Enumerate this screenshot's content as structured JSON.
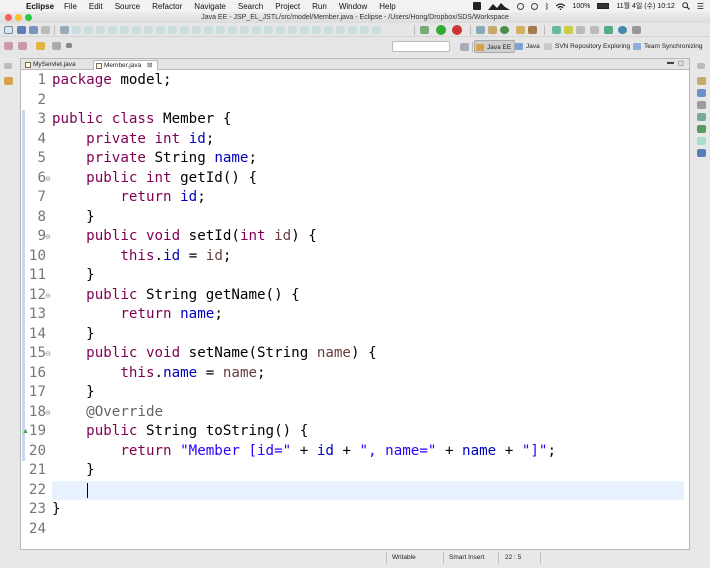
{
  "os_menubar": {
    "app_name": "Eclipse",
    "menus": [
      "File",
      "Edit",
      "Source",
      "Refactor",
      "Navigate",
      "Search",
      "Project",
      "Run",
      "Window",
      "Help"
    ],
    "battery": "100%",
    "datetime": "11월 4일 (수)  10:12"
  },
  "window": {
    "title": "Java EE - JSP_EL_JSTL/src/model/Member.java - Eclipse - /Users/Hong/Dropbox/SDS/Workspace"
  },
  "perspectives": [
    "Java EE",
    "Java",
    "SVN Repository Exploring",
    "Team Synchronizing"
  ],
  "editor": {
    "tabs": [
      {
        "label": "MyServlet.java",
        "active": false
      },
      {
        "label": "Member.java",
        "active": true,
        "close": "⊠"
      }
    ],
    "line_numbers": [
      "1",
      "2",
      "3",
      "4",
      "5",
      "6",
      "7",
      "8",
      "9",
      "10",
      "11",
      "12",
      "13",
      "14",
      "15",
      "16",
      "17",
      "18",
      "19",
      "20",
      "21",
      "22",
      "23",
      "24"
    ],
    "code": [
      {
        "t": "package model;"
      },
      {
        "t": ""
      },
      {
        "t": "public class Member {"
      },
      {
        "t": "    private int id;"
      },
      {
        "t": "    private String name;"
      },
      {
        "t": "    public int getId() {"
      },
      {
        "t": "        return id;"
      },
      {
        "t": "    }"
      },
      {
        "t": "    public void setId(int id) {"
      },
      {
        "t": "        this.id = id;"
      },
      {
        "t": "    }"
      },
      {
        "t": "    public String getName() {"
      },
      {
        "t": "        return name;"
      },
      {
        "t": "    }"
      },
      {
        "t": "    public void setName(String name) {"
      },
      {
        "t": "        this.name = name;"
      },
      {
        "t": "    }"
      },
      {
        "t": "    @Override"
      },
      {
        "t": "    public String toString() {"
      },
      {
        "t": "        return \"Member [id=\" + id + \", name=\" + name + \"]\";"
      },
      {
        "t": "    }"
      },
      {
        "t": ""
      },
      {
        "t": "}"
      },
      {
        "t": ""
      }
    ],
    "current_line": 22
  },
  "status": {
    "writable": "Writable",
    "insert_mode": "Smart Insert",
    "position": "22 : 5"
  }
}
